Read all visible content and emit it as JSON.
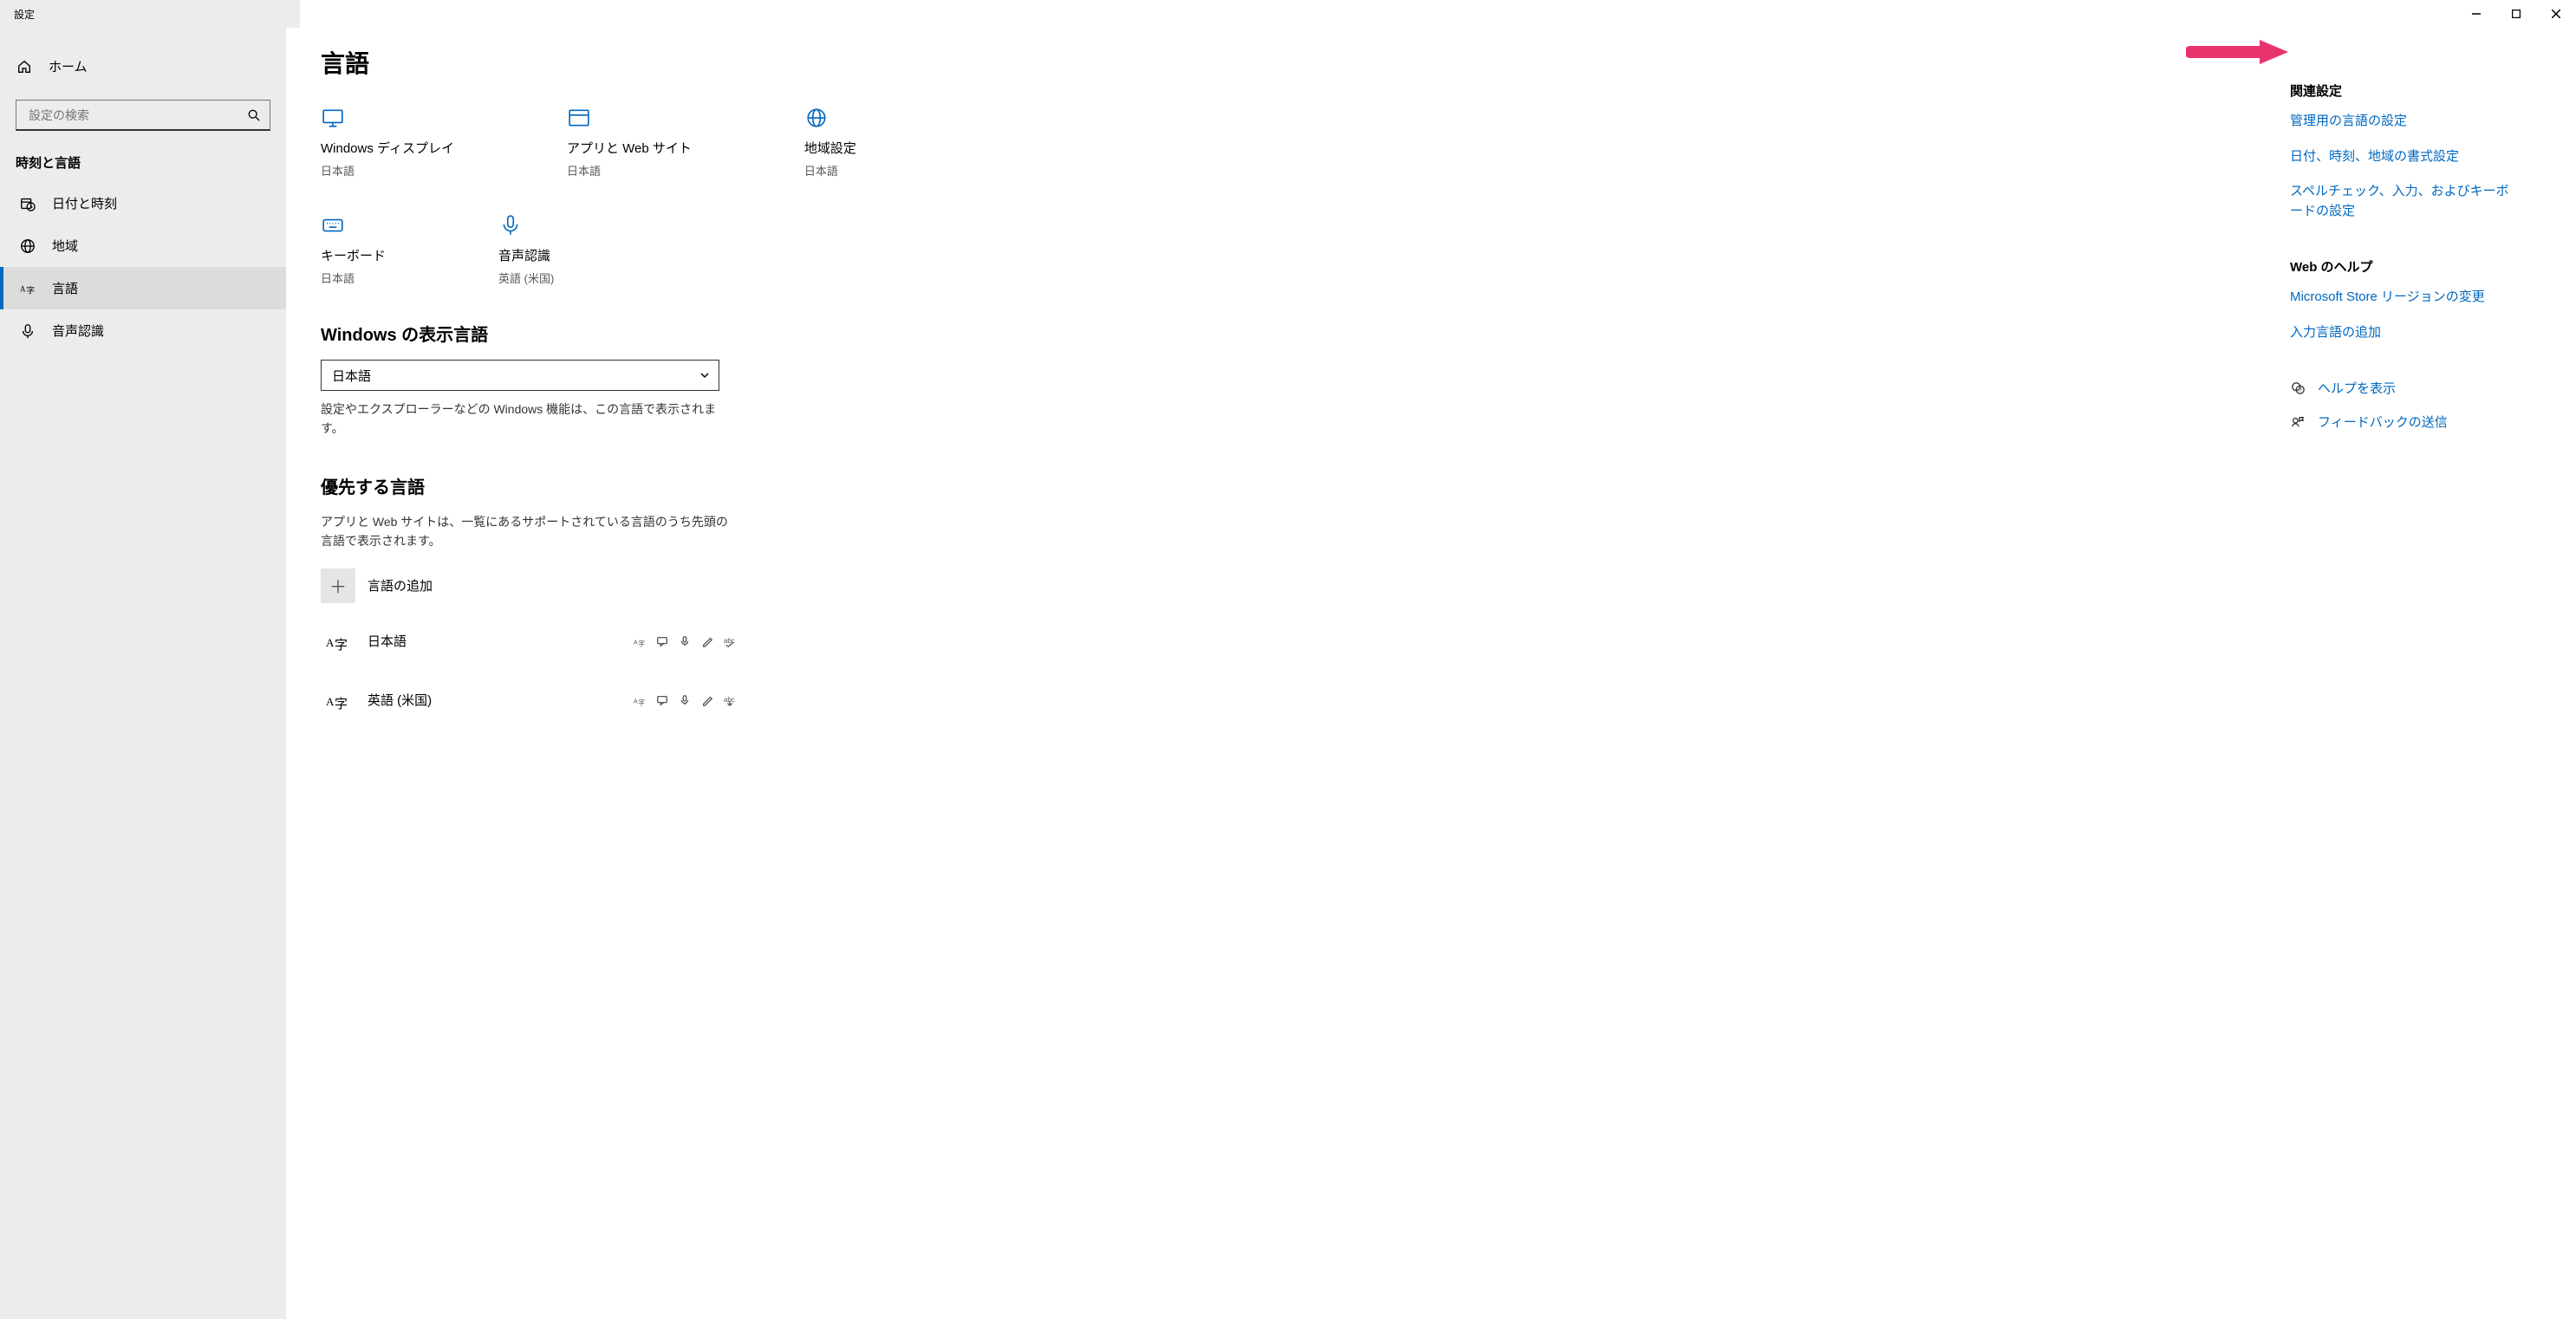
{
  "window": {
    "title": "設定"
  },
  "titlebar_buttons": {
    "min": "minimize",
    "max": "maximize",
    "close": "close"
  },
  "sidebar": {
    "home_label": "ホーム",
    "search_placeholder": "設定の検索",
    "section_title": "時刻と言語",
    "items": [
      {
        "id": "date-time",
        "label": "日付と時刻"
      },
      {
        "id": "region",
        "label": "地域"
      },
      {
        "id": "language",
        "label": "言語",
        "active": true
      },
      {
        "id": "speech",
        "label": "音声認識"
      }
    ]
  },
  "main": {
    "page_title": "言語",
    "tiles": [
      {
        "id": "display",
        "label": "Windows ディスプレイ",
        "value": "日本語"
      },
      {
        "id": "apps",
        "label": "アプリと Web サイト",
        "value": "日本語"
      },
      {
        "id": "region",
        "label": "地域設定",
        "value": "日本語"
      },
      {
        "id": "keyboard",
        "label": "キーボード",
        "value": "日本語"
      },
      {
        "id": "speech",
        "label": "音声認識",
        "value": "英語 (米国)"
      }
    ],
    "display_lang": {
      "heading": "Windows の表示言語",
      "selected": "日本語",
      "desc": "設定やエクスプローラーなどの Windows 機能は、この言語で表示されます。"
    },
    "preferred": {
      "heading": "優先する言語",
      "desc": "アプリと Web サイトは、一覧にあるサポートされている言語のうち先頭の言語で表示されます。",
      "add_label": "言語の追加",
      "languages": [
        {
          "label": "日本語"
        },
        {
          "label": "英語 (米国)"
        }
      ]
    }
  },
  "side": {
    "related_title": "関連設定",
    "links": [
      "管理用の言語の設定",
      "日付、時刻、地域の書式設定",
      "スペルチェック、入力、およびキーボードの設定"
    ],
    "web_help_title": "Web のヘルプ",
    "web_links": [
      "Microsoft Store リージョンの変更",
      "入力言語の追加"
    ],
    "help_label": "ヘルプを表示",
    "feedback_label": "フィードバックの送信"
  }
}
